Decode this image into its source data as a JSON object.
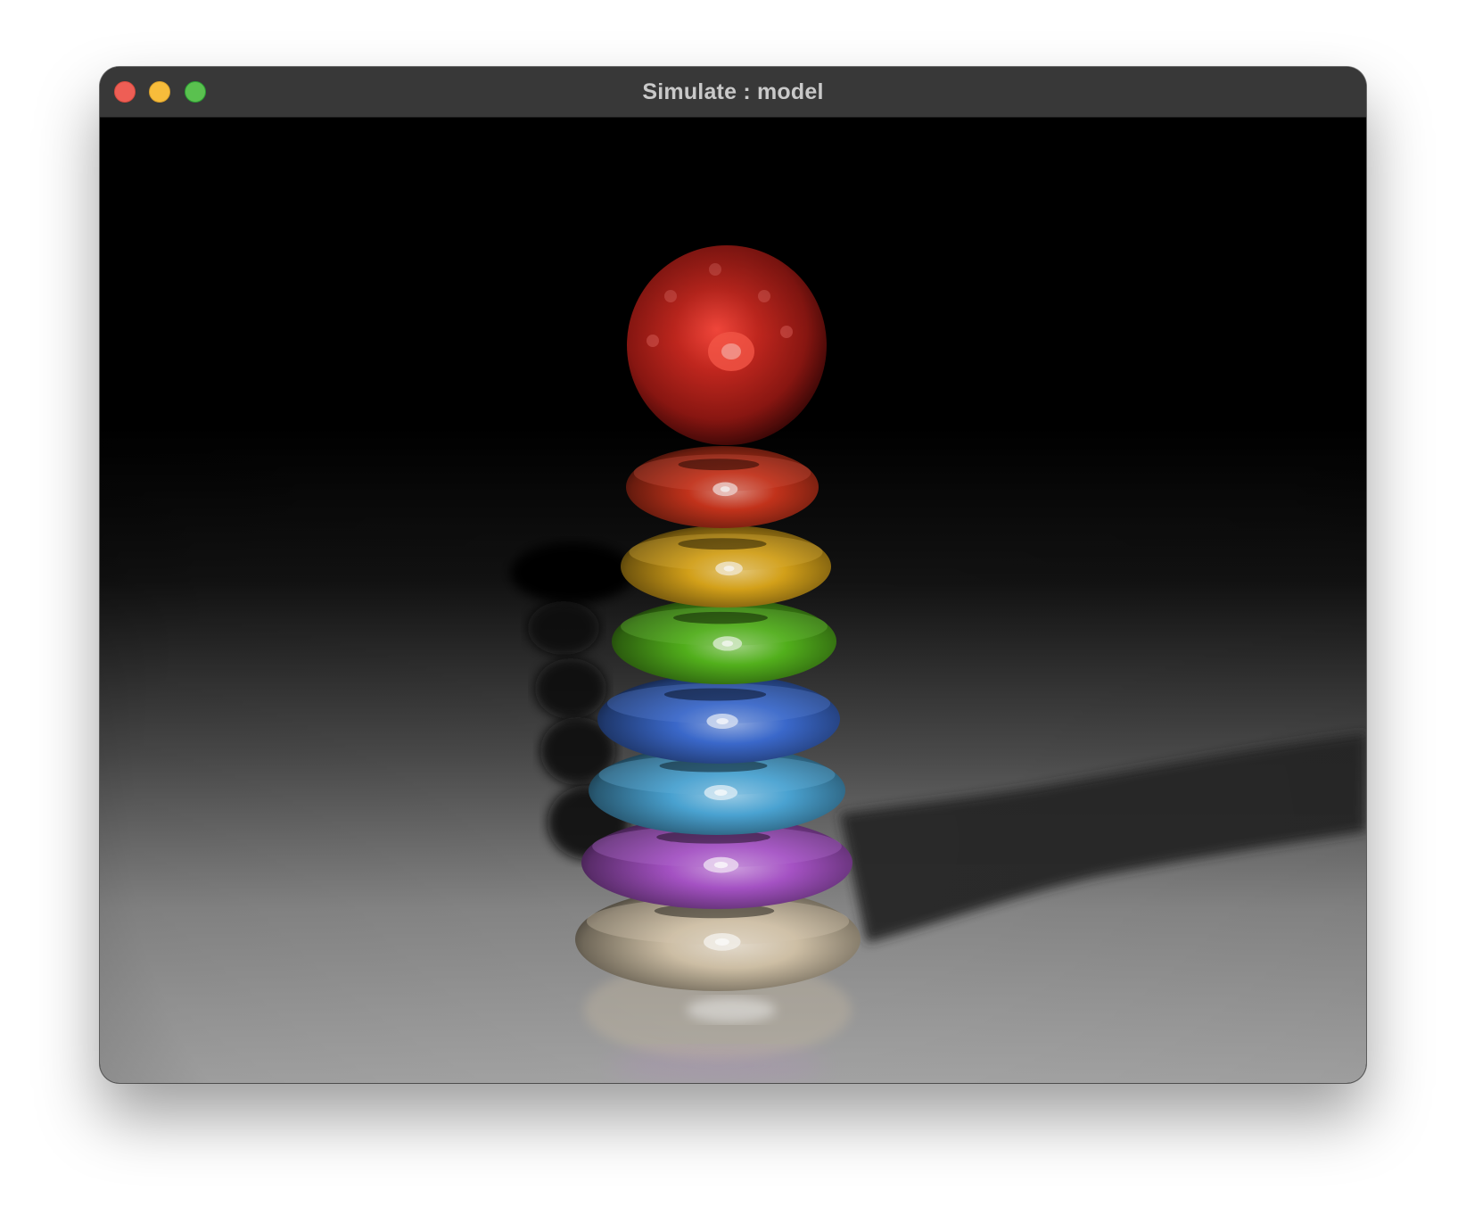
{
  "window": {
    "title": "Simulate : model",
    "controls": {
      "close_color": "#ee5e55",
      "minimize_color": "#f7bc3b",
      "zoom_color": "#5ac14f"
    }
  },
  "scene": {
    "background_color": "#000000",
    "floor_color": "#a6a6a6",
    "sphere_color": "#b0201c",
    "ring_colors": [
      "#c8341c",
      "#d8a41a",
      "#53b21c",
      "#3b69cc",
      "#4aa3d2",
      "#a552c4",
      "#cfc0a6"
    ]
  }
}
